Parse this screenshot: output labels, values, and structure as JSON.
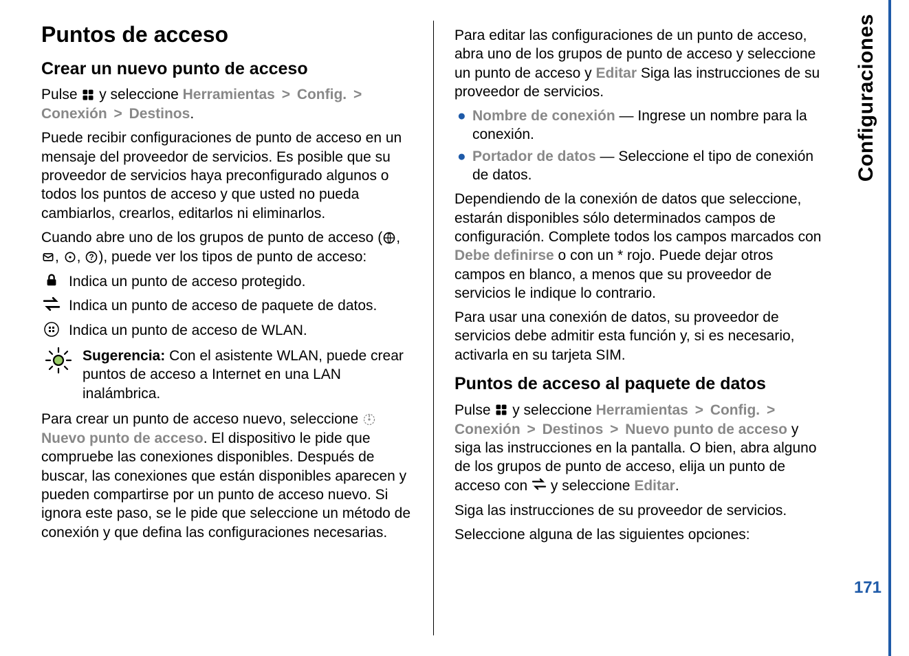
{
  "side_tab": "Configuraciones",
  "page_number": "171",
  "left": {
    "h1": "Puntos de acceso",
    "h2": "Crear un nuevo punto de acceso",
    "nav_intro_pre": "Pulse ",
    "nav_intro_mid": " y seleccione ",
    "nav": {
      "a": "Herramientas",
      "b": "Config.",
      "c": "Conexión",
      "d": "Destinos"
    },
    "p_receive": "Puede recibir configuraciones de punto de acceso en un mensaje del proveedor de servicios. Es posible que su proveedor de servicios haya preconfigurado algunos o todos los puntos de acceso y que usted no pueda cambiarlos, crearlos, editarlos ni eliminarlos.",
    "p_groups_pre": "Cuando abre uno de los grupos de punto de acceso (",
    "p_groups_post": "), puede ver los tipos de punto de acceso:",
    "icons": {
      "lock": "Indica un punto de acceso protegido.",
      "packet": "Indica un punto de acceso de paquete de datos.",
      "wlan": "Indica un punto de acceso de WLAN."
    },
    "tip_label": "Sugerencia:",
    "tip_text": "Con el asistente WLAN, puede crear puntos de acceso a Internet en una LAN inalámbrica.",
    "p_create_pre": "Para crear un punto de acceso nuevo, seleccione ",
    "p_create_ui": "Nuevo punto de acceso",
    "p_create_post": ". El dispositivo le pide que compruebe las conexiones disponibles. Después de buscar, las conexiones que están disponibles aparecen y pueden compartirse por un punto de acceso nuevo. Si ignora este paso, se le pide que seleccione un método de conexión y que defina las configuraciones necesarias."
  },
  "right": {
    "p_edit_pre": "Para editar las configuraciones de un punto de acceso, abra uno de los grupos de punto de acceso y seleccione un punto de acceso y ",
    "p_edit_ui": "Editar",
    "p_edit_post": " Siga las instrucciones de su proveedor de servicios.",
    "bullets": {
      "name_label": "Nombre de conexión",
      "name_text": " — Ingrese un nombre para la conexión.",
      "bearer_label": "Portador de datos",
      "bearer_text": " — Seleccione el tipo de conexión de datos."
    },
    "p_define_pre": "Dependiendo de la conexión de datos que seleccione, estarán disponibles sólo determinados campos de configuración. Complete todos los campos marcados con ",
    "p_define_ui": "Debe definirse",
    "p_define_post": " o con un * rojo. Puede dejar otros campos en blanco, a menos que su proveedor de servicios le indique lo contrario.",
    "p_sim": "Para usar una conexión de datos, su proveedor de servicios debe admitir esta función y, si es necesario, activarla en su tarjeta SIM.",
    "h2": "Puntos de acceso al paquete de datos",
    "nav_intro_pre": "Pulse ",
    "nav_intro_mid": " y seleccione ",
    "nav": {
      "a": "Herramientas",
      "b": "Config.",
      "c": "Conexión",
      "d": "Destinos",
      "e": "Nuevo punto de acceso"
    },
    "nav_post": " y siga las instrucciones en la pantalla. O bien, abra alguno de los grupos de punto de acceso, elija un punto de acceso con ",
    "nav_post2": " y seleccione ",
    "nav_edit": "Editar",
    "p_follow": "Siga las instrucciones de su proveedor de servicios.",
    "p_select": "Seleccione alguna de las siguientes opciones:"
  }
}
